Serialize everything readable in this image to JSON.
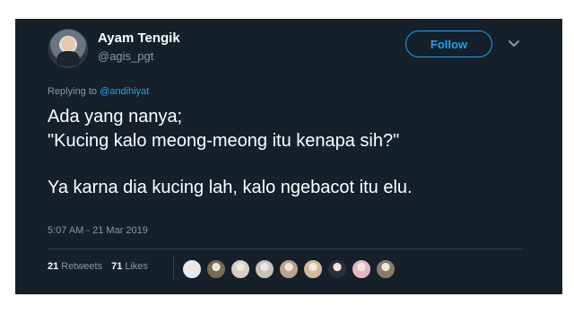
{
  "author": {
    "display_name": "Ayam Tengik",
    "handle": "@agis_pgt"
  },
  "follow_button": {
    "label": "Follow"
  },
  "reply": {
    "prefix": "Replying to",
    "mention": "@andihiyat"
  },
  "tweet": {
    "line1": "Ada yang nanya;",
    "line2": "\"Kucing kalo meong-meong itu kenapa sih?\"",
    "line3": "Ya karna dia kucing lah, kalo ngebacot itu elu."
  },
  "timestamp": "5:07 AM - 21 Mar 2019",
  "stats": {
    "retweets_count": "21",
    "retweets_label": "Retweets",
    "likes_count": "71",
    "likes_label": "Likes"
  },
  "liker_avatars": [
    {
      "color": "#e8ebee"
    },
    {
      "color": "#7a6a55"
    },
    {
      "color": "#d8cfc2"
    },
    {
      "color": "#c9c2bb"
    },
    {
      "color": "#b9a58f"
    },
    {
      "color": "#d2b89c"
    },
    {
      "color": "#2b2f33"
    },
    {
      "color": "#e2b7c0"
    },
    {
      "color": "#8a7a6b"
    }
  ],
  "colors": {
    "background": "#15202b",
    "accent": "#1da1f2",
    "muted_text": "#8899a6"
  }
}
